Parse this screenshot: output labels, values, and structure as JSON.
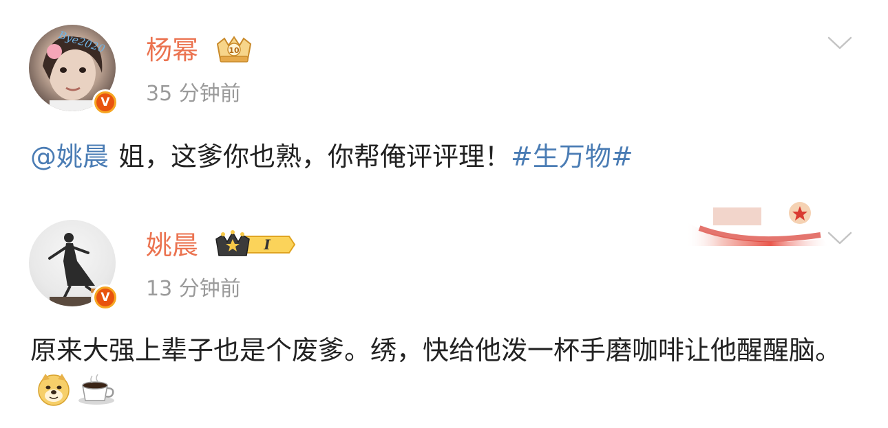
{
  "posts": [
    {
      "username": "杨幂",
      "timestamp": "35 分钟前",
      "avatar_deco_text": "Bye2020",
      "verified_label": "V",
      "member_badge_label": "10",
      "content": {
        "mention": "@姚晨",
        "text": "姐，这爹你也熟，你帮俺评评理！",
        "hashtag": "#生万物#"
      }
    },
    {
      "username": "姚晨",
      "timestamp": "13 分钟前",
      "verified_label": "V",
      "member_badge_label": "I",
      "content": {
        "text": "原来大强上辈子也是个废爹。绣，快给他泼一杯手磨咖啡让他醒醒脑。",
        "emojis": [
          "doge-icon",
          "coffee-icon"
        ]
      }
    }
  ],
  "colors": {
    "username": "#eb7350",
    "link": "#4a7cb4",
    "timestamp": "#9a9a9a",
    "verified_outer": "#f6a623",
    "verified_inner": "#e8530f"
  }
}
